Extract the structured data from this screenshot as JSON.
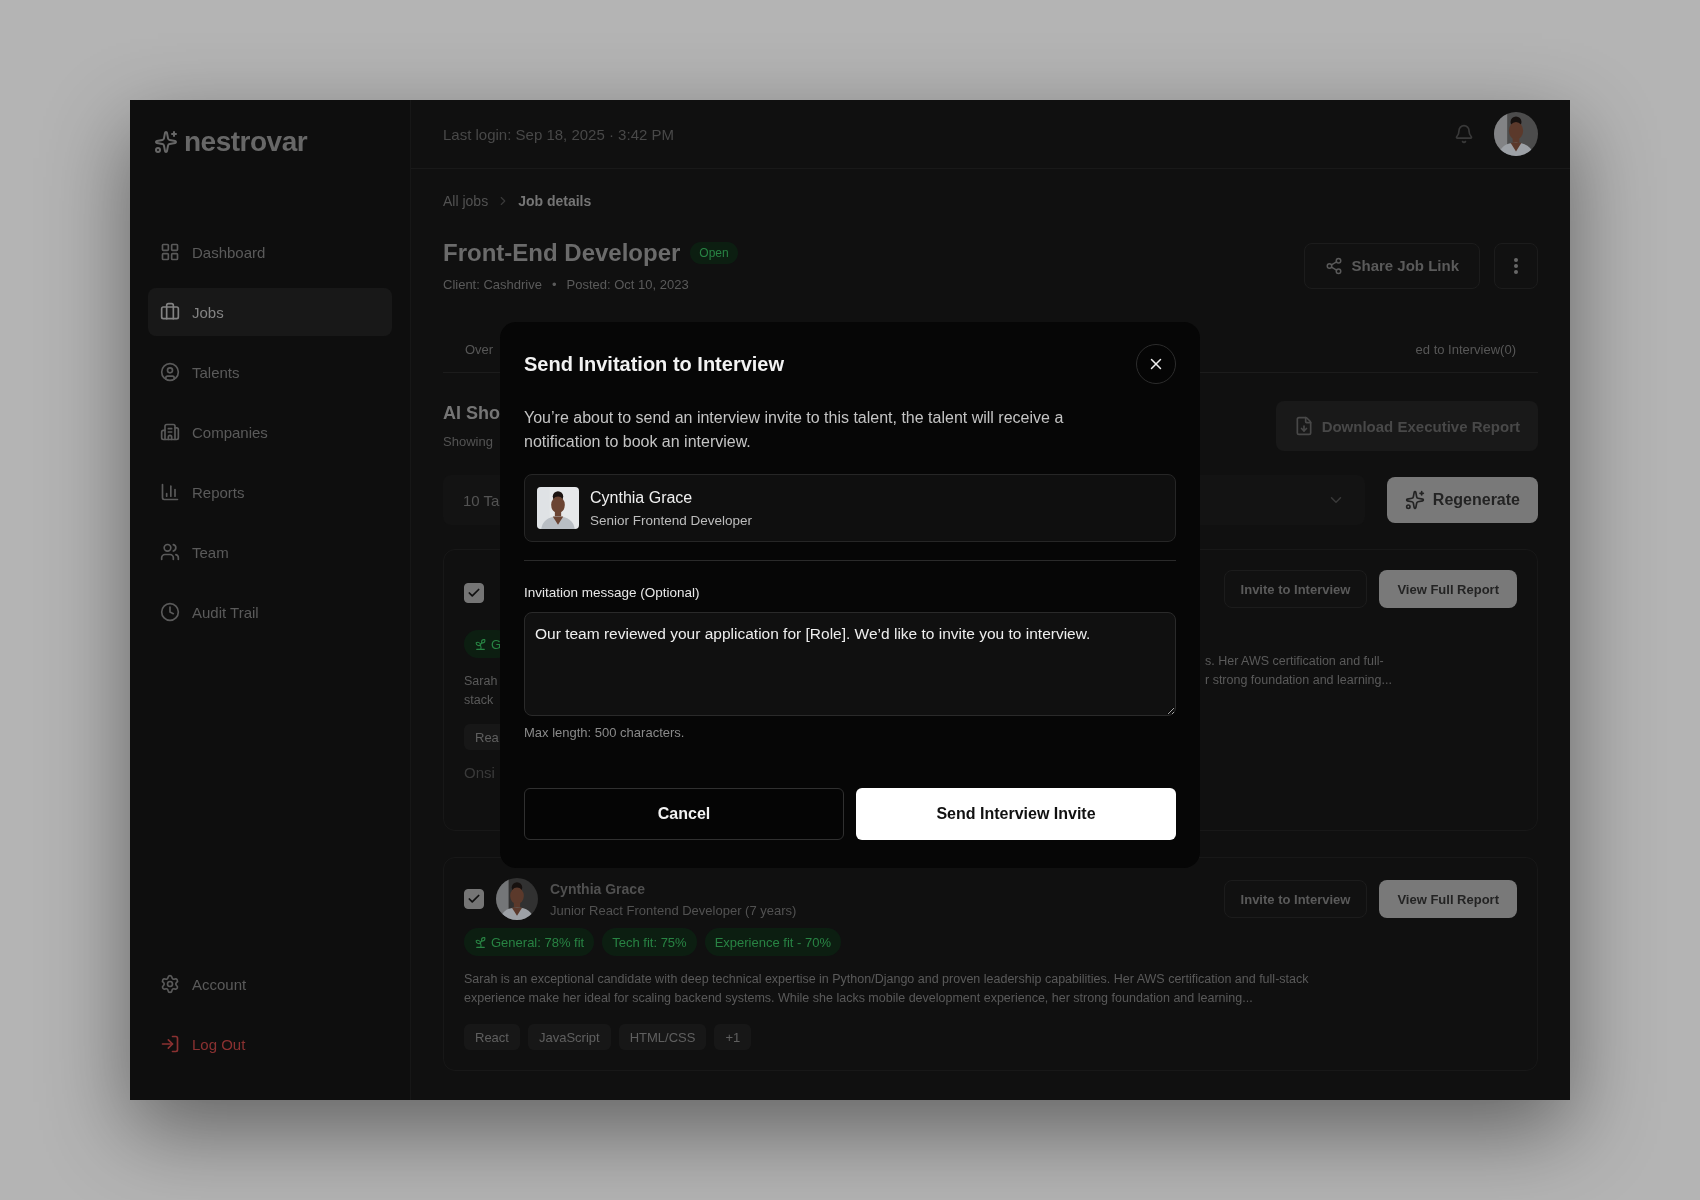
{
  "sidebar": {
    "logo": "nestrovar",
    "nav": [
      {
        "label": "Dashboard",
        "selected": false
      },
      {
        "label": "Jobs",
        "selected": true
      },
      {
        "label": "Talents",
        "selected": false
      },
      {
        "label": "Companies",
        "selected": false
      },
      {
        "label": "Reports",
        "selected": false
      },
      {
        "label": "Team",
        "selected": false
      },
      {
        "label": "Audit Trail",
        "selected": false
      }
    ],
    "bottom": [
      {
        "label": "Account",
        "kind": "normal"
      },
      {
        "label": "Log Out",
        "kind": "danger"
      }
    ]
  },
  "header": {
    "last_login": "Last login: Sep 18, 2025 · 3:42 PM"
  },
  "breadcrumb": [
    "All jobs",
    "Job details"
  ],
  "job": {
    "title": "Front-End Developer",
    "status": "Open",
    "client": "Client: Cashdrive",
    "separator": "•",
    "posted": "Posted: Oct 10, 2023",
    "share": "Share Job Link"
  },
  "tabs": [
    {
      "label": "Over",
      "selected": false
    },
    {
      "label": "ed to Interview(0)",
      "selected": false
    }
  ],
  "section": {
    "title": "AI Sho",
    "subtitle": "Showing",
    "download": "Download Executive Report",
    "filter_value": "10 Ta",
    "regenerate": "Regenerate"
  },
  "first_card": {
    "checked": true,
    "badge": "G",
    "summary_start": [
      "Sarah",
      "stack"
    ],
    "summary_end": [
      "s. Her AWS certification and full-",
      "r strong foundation and learning..."
    ],
    "tag": "Rea",
    "location": "Onsi",
    "invite": "Invite to Interview",
    "report": "View Full Report"
  },
  "second_card": {
    "checked": true,
    "name": "Cynthia Grace",
    "role": "Junior React Frontend Developer (7 years)",
    "badges": [
      "General: 78% fit",
      "Tech fit: 75%",
      "Experience fit - 70%"
    ],
    "summary": "Sarah is an exceptional candidate with deep technical expertise in Python/Django and proven leadership capabilities. Her AWS certification and full-stack experience make her ideal for scaling backend systems. While she lacks mobile development experience, her strong foundation and learning...",
    "tags": [
      "React",
      "JavaScript",
      "HTML/CSS",
      "+1"
    ],
    "invite": "Invite to Interview",
    "report": "View Full Report"
  },
  "modal": {
    "title": "Send Invitation to Interview",
    "description": "You’re about to send an interview invite to this talent, the talent will receive a notification to book an interview.",
    "talent": {
      "name": "Cynthia Grace",
      "role": "Senior Frontend Developer"
    },
    "message_label": "Invitation message (Optional)",
    "message": "Our team reviewed your application for [Role]. We’d like to invite you to interview.",
    "hint": "Max length: 500 characters.",
    "cancel": "Cancel",
    "submit": "Send Interview Invite"
  }
}
